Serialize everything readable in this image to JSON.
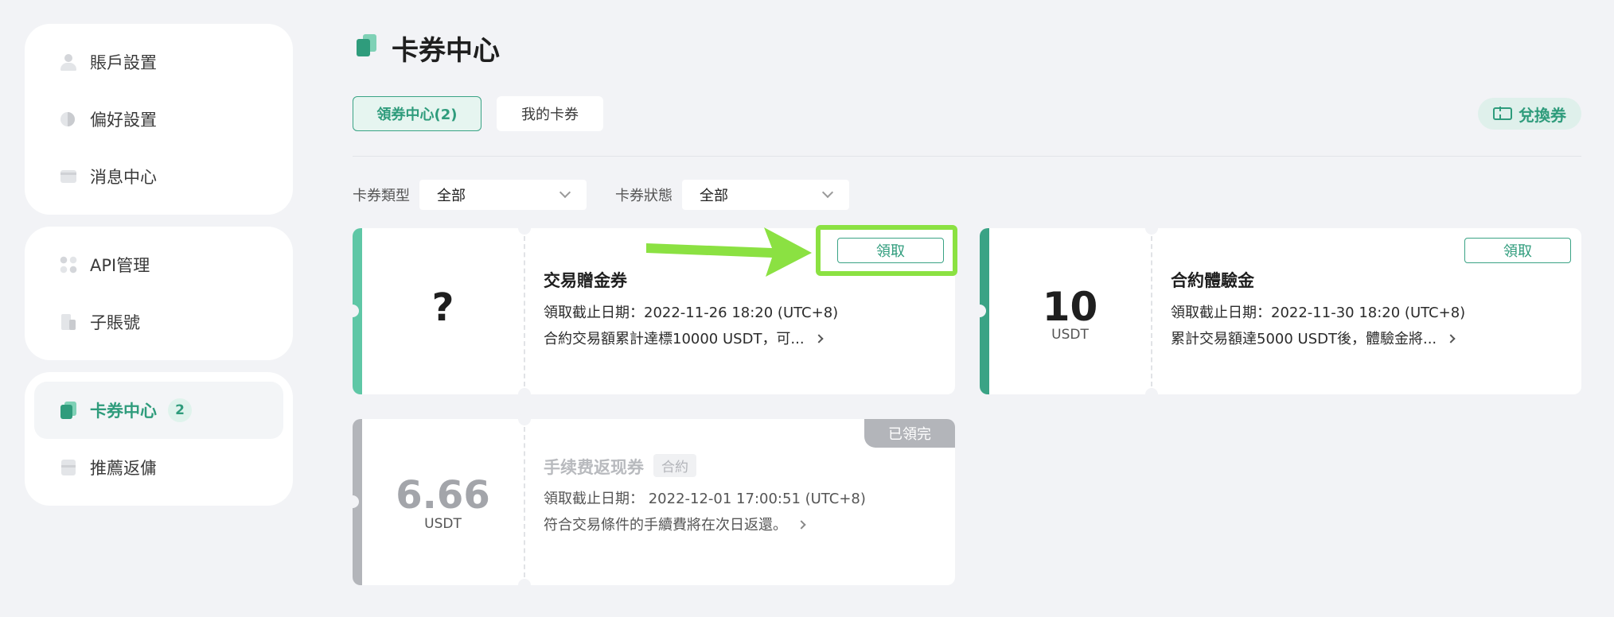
{
  "sidebar": {
    "group1": [
      {
        "label": "賬戶設置",
        "icon": "user-icon"
      },
      {
        "label": "偏好設置",
        "icon": "preferences-icon"
      },
      {
        "label": "消息中心",
        "icon": "message-icon"
      }
    ],
    "group2": [
      {
        "label": "API管理",
        "icon": "api-icon"
      },
      {
        "label": "子賬號",
        "icon": "sub-account-icon"
      }
    ],
    "group3": [
      {
        "label": "卡券中心",
        "icon": "coupon-icon",
        "badge": "2",
        "active": true
      },
      {
        "label": "推薦返傭",
        "icon": "referral-icon"
      }
    ]
  },
  "header": {
    "title": "卡券中心",
    "tabs": [
      {
        "label": "領券中心(2)",
        "active": true
      },
      {
        "label": "我的卡券",
        "active": false
      }
    ],
    "redeem_label": "兌換券"
  },
  "filters": {
    "type_label": "卡券類型",
    "type_value": "全部",
    "status_label": "卡券狀態",
    "status_value": "全部"
  },
  "coupons": [
    {
      "value": "?",
      "unit": "",
      "title": "交易贈金券",
      "deadline": "領取截止日期：2022-11-26 18:20 (UTC+8)",
      "desc": "合約交易額累計達標10000 USDT，可...",
      "action": "領取",
      "strip_color": "#5fc7a6"
    },
    {
      "value": "10",
      "unit": "USDT",
      "title": "合約體驗金",
      "deadline": "領取截止日期：2022-11-30 18:20 (UTC+8)",
      "desc": "累計交易額達5000 USDT後，體驗金將...",
      "action": "領取",
      "strip_color": "#3aa385"
    },
    {
      "value": "6.66",
      "unit": "USDT",
      "title": "手续费返现券",
      "tag": "合約",
      "deadline": "領取截止日期：  2022-12-01 17:00:51 (UTC+8)",
      "desc": "符合交易條件的手續費將在次日返還。",
      "status": "已領完",
      "strip_color": "#b3b5ba"
    }
  ],
  "colors": {
    "accent": "#2f9c7c",
    "highlight": "#8be142",
    "background": "#f2f3f6"
  }
}
